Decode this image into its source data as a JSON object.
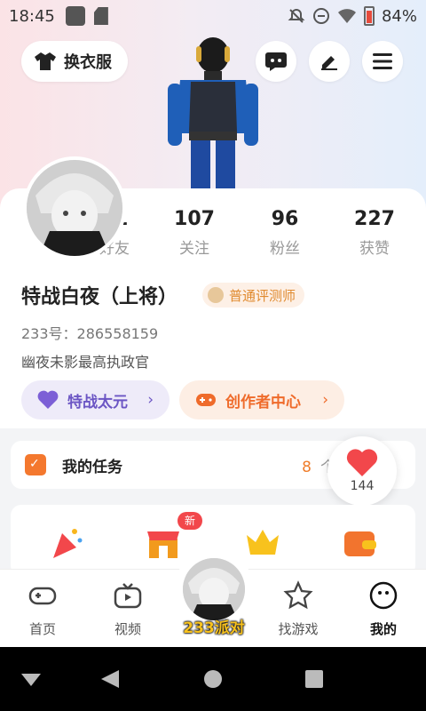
{
  "status_bar": {
    "time": "18:45",
    "battery": "84%"
  },
  "header": {
    "wardrobe_label": "换衣服"
  },
  "profile": {
    "stats": [
      {
        "value": "91",
        "label": "好友"
      },
      {
        "value": "107",
        "label": "关注"
      },
      {
        "value": "96",
        "label": "粉丝"
      },
      {
        "value": "227",
        "label": "获赞"
      }
    ],
    "name": "特战白夜（上将）",
    "badge": "普通评测师",
    "uid": "233号：286558159",
    "signature": "幽夜未影最高执政官",
    "pill_left": "特战太元",
    "pill_right": "创作者中心"
  },
  "tasks": {
    "title": "我的任务",
    "count": "8",
    "count_suffix": "个任务"
  },
  "likes": {
    "count": "144"
  },
  "functions": {
    "new_badge": "新",
    "shop_text": "SHOP"
  },
  "tabbar": {
    "tabs": [
      "首页",
      "视频",
      "找游戏",
      "我的"
    ],
    "center_label": "233派对"
  },
  "colors": {
    "accent_orange": "#ef6b2b",
    "accent_purple": "#6b55c4",
    "heart_red": "#f2474b"
  }
}
